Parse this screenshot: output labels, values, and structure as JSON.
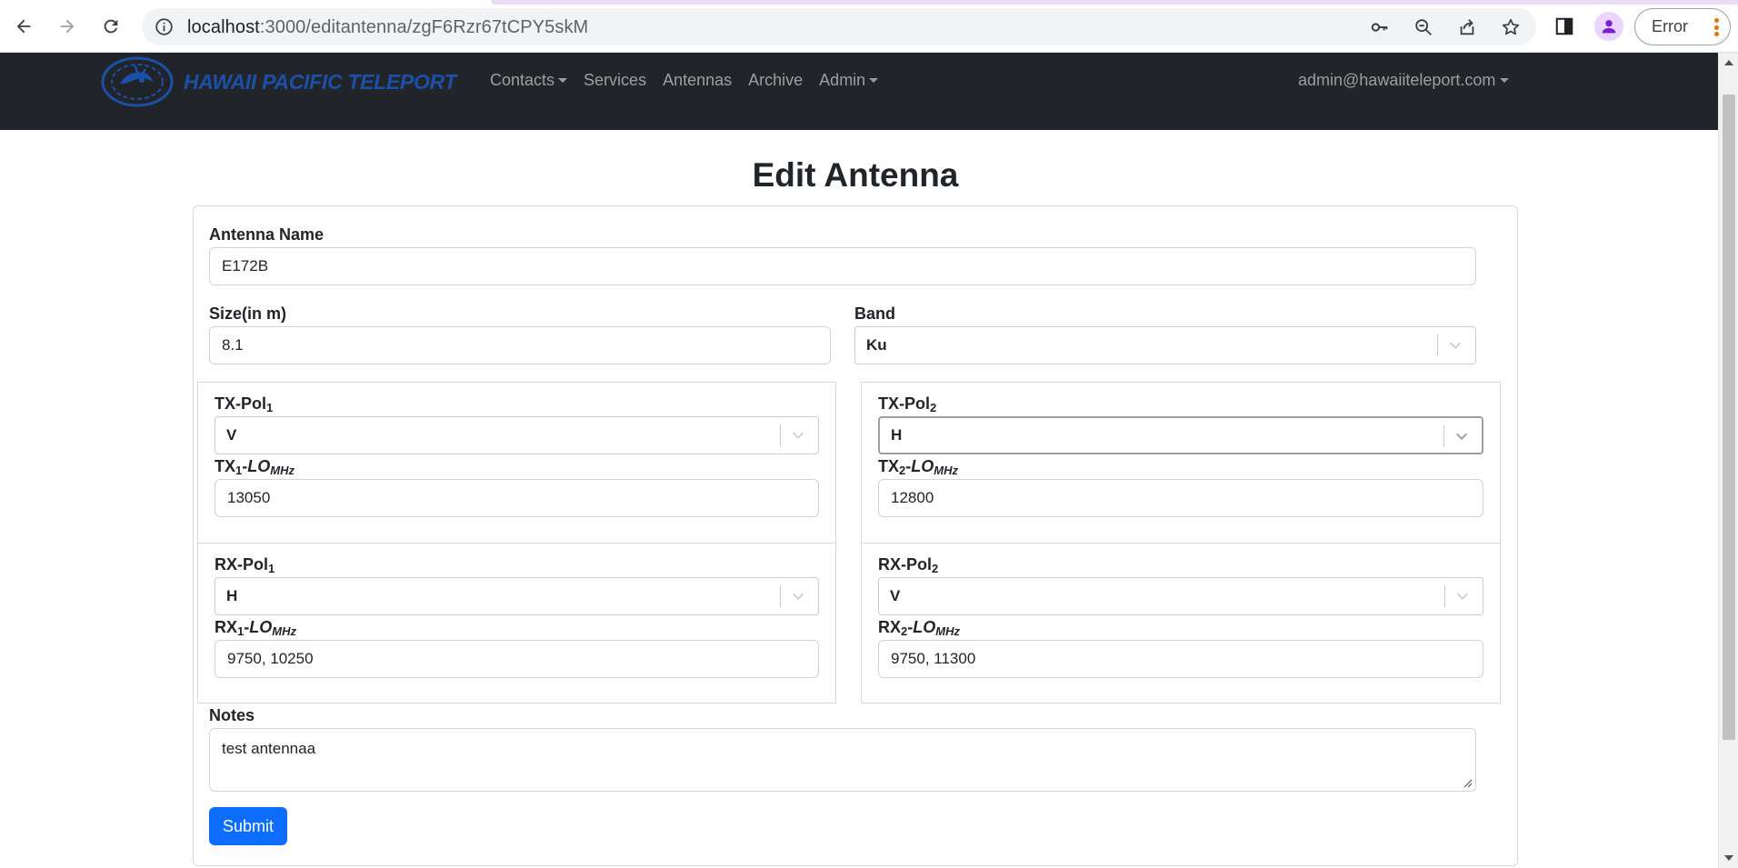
{
  "browser": {
    "url_host": "localhost",
    "url_path": ":3000/editantenna/zgF6Rzr67tCPY5skM",
    "error_chip_label": "Error"
  },
  "navbar": {
    "brand": "HAWAII PACIFIC TELEPORT",
    "links": {
      "contacts": "Contacts",
      "services": "Services",
      "antennas": "Antennas",
      "archive": "Archive",
      "admin": "Admin"
    },
    "user_email": "admin@hawaiiteleport.com"
  },
  "page": {
    "title": "Edit Antenna"
  },
  "form": {
    "name_label": "Antenna Name",
    "name_value": "E172B",
    "size_label": "Size(in m)",
    "size_value": "8.1",
    "band_label": "Band",
    "band_value": "Ku",
    "tx1": {
      "pol_label": "TX-Pol",
      "pol_sub": "1",
      "pol_value": "V",
      "lo_label": "TX",
      "lo_sub": "1",
      "lo_suffix": "LO",
      "lo_unit": "MHz",
      "lo_value": "13050"
    },
    "tx2": {
      "pol_label": "TX-Pol",
      "pol_sub": "2",
      "pol_value": "H",
      "lo_label": "TX",
      "lo_sub": "2",
      "lo_suffix": "LO",
      "lo_unit": "MHz",
      "lo_value": "12800"
    },
    "rx1": {
      "pol_label": "RX-Pol",
      "pol_sub": "1",
      "pol_value": "H",
      "lo_label": "RX",
      "lo_sub": "1",
      "lo_suffix": "LO",
      "lo_unit": "MHz",
      "lo_value": "9750, 10250"
    },
    "rx2": {
      "pol_label": "RX-Pol",
      "pol_sub": "2",
      "pol_value": "V",
      "lo_label": "RX",
      "lo_sub": "2",
      "lo_suffix": "LO",
      "lo_unit": "MHz",
      "lo_value": "9750, 11300"
    },
    "notes_label": "Notes",
    "notes_value": "test antennaa",
    "submit_label": "Submit"
  },
  "colors": {
    "navbar_bg": "#212529",
    "brand": "#1b4fa8",
    "primary_button": "#0d6efd"
  }
}
